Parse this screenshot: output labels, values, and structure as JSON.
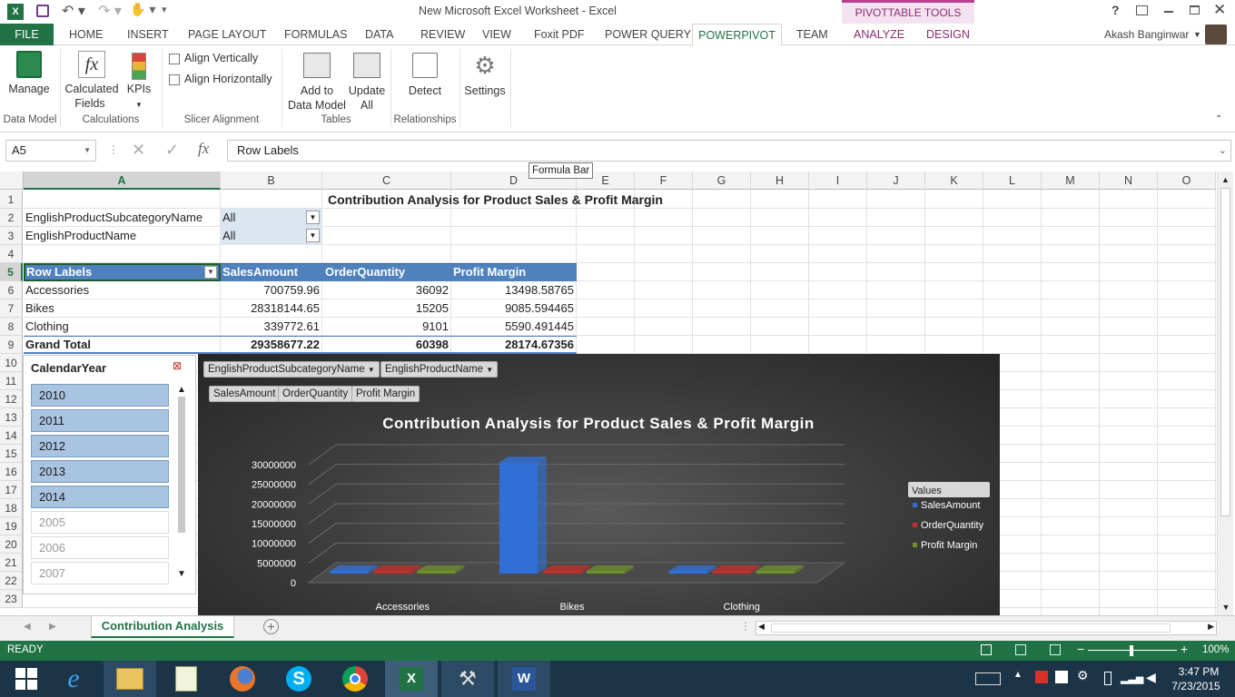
{
  "app": {
    "title": "New Microsoft Excel Worksheet - Excel",
    "context_title": "PIVOTTABLE TOOLS",
    "user": "Akash Banginwar",
    "help": "?"
  },
  "tabs": {
    "file": "FILE",
    "home": "HOME",
    "insert": "INSERT",
    "page_layout": "PAGE LAYOUT",
    "formulas": "FORMULAS",
    "data": "DATA",
    "review": "REVIEW",
    "view": "VIEW",
    "foxit": "Foxit PDF",
    "power_query": "POWER QUERY",
    "powerpivot": "POWERPIVOT",
    "team": "TEAM",
    "analyze": "ANALYZE",
    "design": "DESIGN"
  },
  "ribbon": {
    "manage": "Manage",
    "calc_fields": "Calculated",
    "calc_fields2": "Fields",
    "kpis": "KPIs",
    "align_v": "Align Vertically",
    "align_h": "Align Horizontally",
    "add_model": "Add to",
    "add_model2": "Data Model",
    "update_all": "Update",
    "update_all2": "All",
    "detect": "Detect",
    "settings": "Settings",
    "groups": {
      "data_model": "Data Model",
      "calculations": "Calculations",
      "slicer_alignment": "Slicer Alignment",
      "tables": "Tables",
      "relationships": "Relationships"
    }
  },
  "formula_bar": {
    "name_box": "A5",
    "content": "Row Labels",
    "tooltip": "Formula Bar",
    "fx": "fx"
  },
  "columns": [
    "A",
    "B",
    "C",
    "D",
    "E",
    "F",
    "G",
    "H",
    "I",
    "J",
    "K",
    "L",
    "M",
    "N",
    "O"
  ],
  "rows": [
    "1",
    "2",
    "3",
    "4",
    "5",
    "6",
    "7",
    "8",
    "9",
    "10",
    "11",
    "12",
    "13",
    "14",
    "15",
    "16",
    "17",
    "18",
    "19",
    "20",
    "21",
    "22",
    "23"
  ],
  "sheet": {
    "title": "Contribution Analysis for Product Sales & Profit Margin",
    "filter1_label": "EnglishProductSubcategoryName",
    "filter1_value": "All",
    "filter2_label": "EnglishProductName",
    "filter2_value": "All",
    "headers": {
      "row_labels": "Row Labels",
      "sales": "SalesAmount",
      "qty": "OrderQuantity",
      "margin": "Profit Margin"
    },
    "data": [
      {
        "label": "Accessories",
        "sales": "700759.96",
        "qty": "36092",
        "margin": "13498.58765"
      },
      {
        "label": "Bikes",
        "sales": "28318144.65",
        "qty": "15205",
        "margin": "9085.594465"
      },
      {
        "label": "Clothing",
        "sales": "339772.61",
        "qty": "9101",
        "margin": "5590.491445"
      }
    ],
    "total": {
      "label": "Grand Total",
      "sales": "29358677.22",
      "qty": "60398",
      "margin": "28174.67356"
    }
  },
  "slicer": {
    "title": "CalendarYear",
    "items": [
      {
        "label": "2010",
        "selected": true
      },
      {
        "label": "2011",
        "selected": true
      },
      {
        "label": "2012",
        "selected": true
      },
      {
        "label": "2013",
        "selected": true
      },
      {
        "label": "2014",
        "selected": true
      },
      {
        "label": "2005",
        "selected": false
      },
      {
        "label": "2006",
        "selected": false
      },
      {
        "label": "2007",
        "selected": false
      }
    ]
  },
  "pivot_chart": {
    "filter_btn1": "EnglishProductSubcategoryName",
    "filter_btn2": "EnglishProductName",
    "value_btn1": "SalesAmount",
    "value_btn2": "OrderQuantity",
    "value_btn3": "Profit Margin",
    "legend_title": "Values"
  },
  "chart_data": {
    "type": "bar",
    "title": "Contribution Analysis for Product Sales & Profit Margin",
    "categories": [
      "Accessories",
      "Bikes",
      "Clothing"
    ],
    "series": [
      {
        "name": "SalesAmount",
        "values": [
          700759.96,
          28318144.65,
          339772.61
        ],
        "color": "#2f6fd6"
      },
      {
        "name": "OrderQuantity",
        "values": [
          36092,
          15205,
          9101
        ],
        "color": "#c0302a"
      },
      {
        "name": "Profit Margin",
        "values": [
          13498.58765,
          9085.594465,
          5590.491445
        ],
        "color": "#6f8f2a"
      }
    ],
    "yticks": [
      "30000000",
      "25000000",
      "20000000",
      "15000000",
      "10000000",
      "5000000",
      "0"
    ],
    "ylim": [
      0,
      30000000
    ],
    "legend": "right",
    "grid": true
  },
  "sheet_tab": "Contribution Analysis",
  "status": {
    "ready": "READY",
    "zoom": "100%"
  },
  "clock": {
    "time": "3:47 PM",
    "date": "7/23/2015"
  }
}
